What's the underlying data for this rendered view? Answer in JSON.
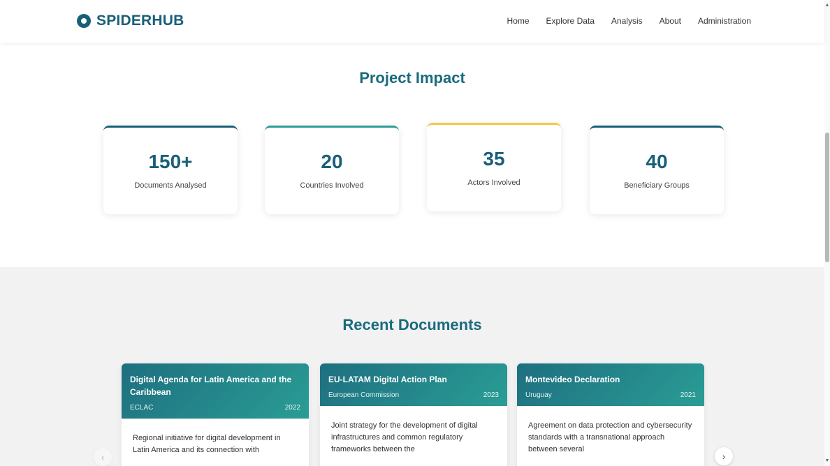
{
  "brand": {
    "name": "SPIDERHUB",
    "logo_icon": "globe-logo-icon",
    "color": "#1a5f7a"
  },
  "nav": {
    "items": [
      "Home",
      "Explore Data",
      "Analysis",
      "About",
      "Administration"
    ]
  },
  "impact": {
    "title": "Project Impact",
    "stats": [
      {
        "value": "150+",
        "label": "Documents Analysed",
        "accent": "#1a5f7a"
      },
      {
        "value": "20",
        "label": "Countries Involved",
        "accent": "#2a9d95"
      },
      {
        "value": "35",
        "label": "Actors Involved",
        "accent": "#f2c94c"
      },
      {
        "value": "40",
        "label": "Beneficiary Groups",
        "accent": "#1a5f7a"
      }
    ]
  },
  "recent": {
    "title": "Recent Documents",
    "documents": [
      {
        "title": "Digital Agenda for Latin America and the Caribbean",
        "org": "ECLAC",
        "year": "2022",
        "summary": "Regional initiative for digital development in Latin America and its connection with"
      },
      {
        "title": "EU-LATAM Digital Action Plan",
        "org": "European Commission",
        "year": "2023",
        "summary": "Joint strategy for the development of digital infrastructures and common regulatory frameworks between the"
      },
      {
        "title": "Montevideo Declaration",
        "org": "Uruguay",
        "year": "2021",
        "summary": "Agreement on data protection and cybersecurity standards with a transnational approach between several"
      }
    ],
    "prev_icon": "chevron-left-icon",
    "next_icon": "chevron-right-icon"
  },
  "colors": {
    "primary": "#1a5f7a",
    "heading": "#1a6b7e",
    "teal": "#2a9d95",
    "gold": "#f2c94c",
    "section_bg": "#f2f2f2"
  }
}
